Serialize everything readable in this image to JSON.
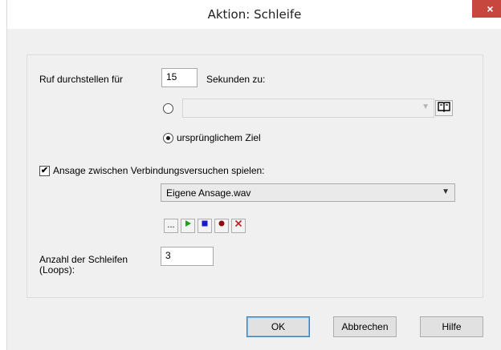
{
  "window": {
    "title": "Aktion: Schleife",
    "close_label": "×"
  },
  "form": {
    "forward_label": "Ruf durchstellen für",
    "seconds_value": "15",
    "seconds_suffix": "Sekunden zu:",
    "target_combo_value": "",
    "original_target_label": "ursprünglichem Ziel",
    "announcement_checkbox_label": "Ansage zwischen Verbindungsversuchen spielen:",
    "announcement_checked": true,
    "announcement_file": "Eigene Ansage.wav",
    "loops_label_line1": "Anzahl der Schleifen",
    "loops_label_line2": "(Loops):",
    "loops_value": "3"
  },
  "media_buttons": {
    "browse": "...",
    "play_icon": "play-icon",
    "stop_icon": "stop-icon",
    "record_icon": "record-icon",
    "delete_icon": "delete-icon"
  },
  "footer": {
    "ok": "OK",
    "cancel": "Abbrechen",
    "help": "Hilfe"
  },
  "colors": {
    "close_bg": "#c7463d",
    "play": "#17a617",
    "stop": "#1a1acc",
    "record": "#8b0d0d",
    "delete": "#c42020"
  }
}
